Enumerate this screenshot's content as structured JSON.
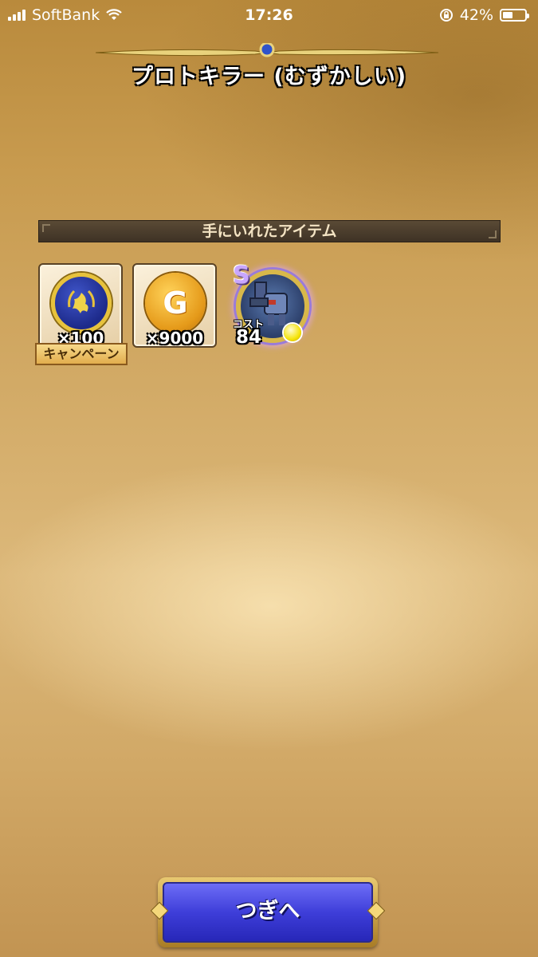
{
  "status_bar": {
    "carrier": "SoftBank",
    "time": "17:26",
    "battery_percent": "42%",
    "battery_level": 0.42,
    "icons": [
      "signal-icon",
      "wifi-icon",
      "rotation-lock-icon",
      "battery-icon"
    ]
  },
  "stage": {
    "title": "プロトキラー (むずかしい)"
  },
  "rewards": {
    "header": "手にいれたアイテム",
    "items": [
      {
        "icon": "medal-icon",
        "quantity": "×100",
        "ribbon": "キャンペーン"
      },
      {
        "icon": "gold-coin-icon",
        "coin_letter": "G",
        "quantity": "×9000"
      }
    ],
    "monster": {
      "rank": "S",
      "cost_label": "コスト",
      "cost_value": "84",
      "icon": "monster-orb-icon"
    }
  },
  "buttons": {
    "next_label": "つぎへ"
  },
  "colors": {
    "button_blue": "#3e3ed9",
    "button_gold": "#e8c870",
    "header_bar": "#4b3d2d",
    "background": "#d2aa66"
  }
}
